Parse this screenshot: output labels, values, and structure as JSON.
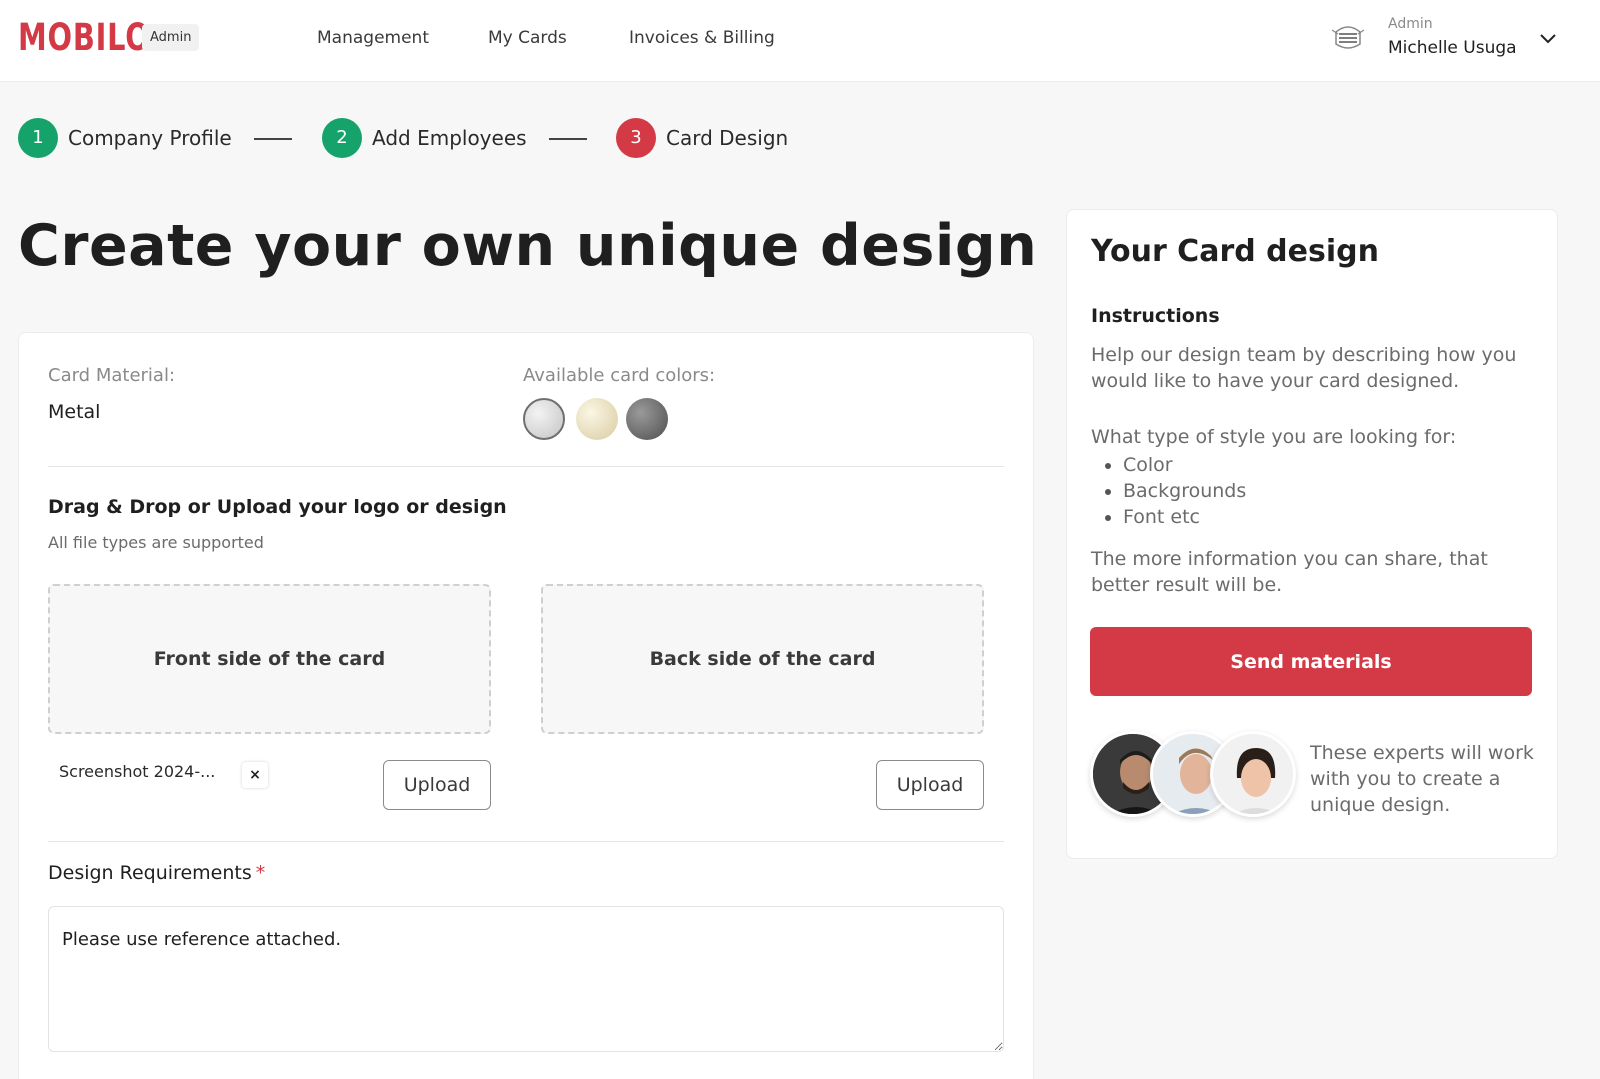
{
  "header": {
    "logo": "MOBILO",
    "role_chip": "Admin",
    "nav": [
      "Management",
      "My Cards",
      "Invoices & Billing"
    ],
    "user": {
      "role": "Admin",
      "name": "Michelle Usuga"
    }
  },
  "stepper": {
    "steps": [
      {
        "number": "1",
        "label": "Company Profile",
        "state": "done"
      },
      {
        "number": "2",
        "label": "Add Employees",
        "state": "done"
      },
      {
        "number": "3",
        "label": "Card Design",
        "state": "active"
      }
    ]
  },
  "page_title": "Create your own unique design",
  "card_form": {
    "material_label": "Card Material:",
    "material_value": "Metal",
    "colors_label": "Available card colors:",
    "colors": [
      {
        "name": "silver",
        "hex": "#d6d6d6",
        "selected": true
      },
      {
        "name": "gold",
        "hex": "#e8dcb5",
        "selected": false
      },
      {
        "name": "gunmetal",
        "hex": "#6b6b6b",
        "selected": false
      }
    ],
    "upload_title": "Drag & Drop or Upload your logo or design",
    "upload_subtitle": "All file types are supported",
    "front_label": "Front side of the card",
    "back_label": "Back side of the card",
    "front_file": "Screenshot 2024-...",
    "remove_symbol": "×",
    "upload_button": "Upload",
    "requirements_label": "Design Requirements",
    "requirements_required": "*",
    "requirements_value": "Please use reference attached."
  },
  "side_panel": {
    "title": "Your Card design",
    "instructions_heading": "Instructions",
    "intro": "Help our design team by describing how you would like to have your card designed.",
    "style_prompt": "What type of style you are looking for:",
    "style_items": [
      "Color",
      "Backgrounds",
      "Font etc"
    ],
    "closing": "The more information you can share, that better result will be.",
    "send_button": "Send materials",
    "experts_text": "These experts will work with you to create a unique design."
  },
  "colors": {
    "brand_red": "#d33a45",
    "success_green": "#15a36b"
  }
}
